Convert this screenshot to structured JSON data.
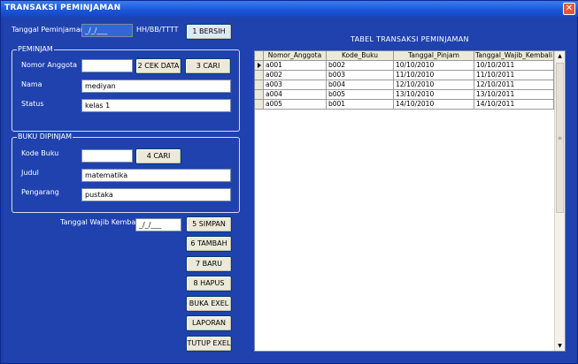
{
  "window": {
    "title": "TRANSAKSI PEMINJAMAN",
    "close_glyph": "✕"
  },
  "top": {
    "tanggal_label": "Tanggal Peminjaman",
    "tanggal_value": "_/_/___",
    "tanggal_hint": "HH/BB/TTTT",
    "bersih_button": "1 BERSIH"
  },
  "peminjam": {
    "frame_title": "PEMINJAM",
    "nomor_label": "Nomor Anggota",
    "nomor_value": "",
    "cek_button": "2 CEK DATA",
    "cari_button": "3 CARI",
    "nama_label": "Nama",
    "nama_value": "mediyan",
    "status_label": "Status",
    "status_value": "kelas 1"
  },
  "buku": {
    "frame_title": "BUKU DIPINJAM",
    "kode_label": "Kode Buku",
    "kode_value": "",
    "cari_button": "4 CARI",
    "judul_label": "Judul",
    "judul_value": "matematika",
    "pengarang_label": "Pengarang",
    "pengarang_value": "pustaka"
  },
  "wajib": {
    "label": "Tanggal Wajib Kembali",
    "value": "_/_/___"
  },
  "actions": {
    "simpan": "5 SIMPAN",
    "tambah": "6 TAMBAH",
    "baru": "7 BARU",
    "hapus": "8 HAPUS",
    "buka_exel": "BUKA EXEL",
    "laporan": "LAPORAN",
    "tutup_exel": "TUTUP EXEL"
  },
  "table": {
    "title": "TABEL TRANSAKSI PEMINJAMAN",
    "columns": [
      "Nomor_Anggota",
      "Kode_Buku",
      "Tanggal_Pinjam",
      "Tanggal_Wajib_Kembali"
    ],
    "rows": [
      [
        "a001",
        "b002",
        "10/10/2010",
        "10/10/2011"
      ],
      [
        "a002",
        "b003",
        "11/10/2010",
        "11/10/2011"
      ],
      [
        "a003",
        "b004",
        "12/10/2010",
        "12/10/2011"
      ],
      [
        "a004",
        "b005",
        "13/10/2010",
        "13/10/2011"
      ],
      [
        "a005",
        "b001",
        "14/10/2010",
        "14/10/2011"
      ]
    ]
  },
  "colors": {
    "background": "#1f42ae",
    "titlebar": "#1b55d8",
    "button_face": "#ece9d8"
  }
}
